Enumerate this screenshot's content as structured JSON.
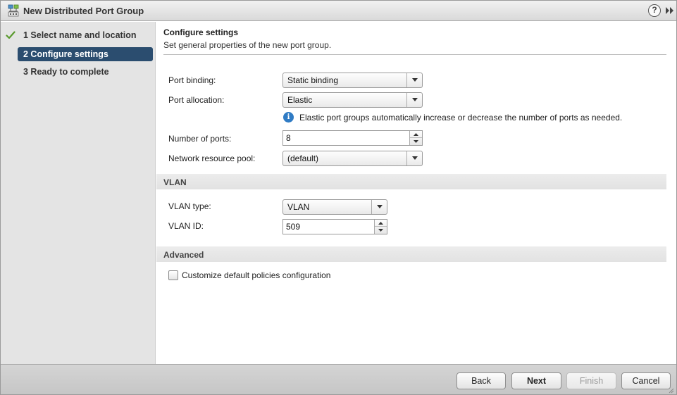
{
  "window": {
    "title": "New Distributed Port Group",
    "help_label": "?",
    "icon": "distributed-port-group-icon"
  },
  "steps": [
    {
      "label": "1  Select name and location",
      "status": "completed"
    },
    {
      "label": "2  Configure settings",
      "status": "active"
    },
    {
      "label": "3  Ready to complete",
      "status": "pending"
    }
  ],
  "main": {
    "title": "Configure settings",
    "subtitle": "Set general properties of the new port group."
  },
  "form": {
    "port_binding": {
      "label": "Port binding:",
      "value": "Static binding"
    },
    "port_allocation": {
      "label": "Port allocation:",
      "value": "Elastic"
    },
    "info": "Elastic port groups automatically increase or decrease the number of ports as needed.",
    "num_ports": {
      "label": "Number of ports:",
      "value": "8"
    },
    "resource_pool": {
      "label": "Network resource pool:",
      "value": "(default)"
    }
  },
  "vlan": {
    "header": "VLAN",
    "type": {
      "label": "VLAN type:",
      "value": "VLAN"
    },
    "id": {
      "label": "VLAN ID:",
      "value": "509"
    }
  },
  "advanced": {
    "header": "Advanced",
    "customize": {
      "label": "Customize default policies configuration",
      "checked": false
    }
  },
  "footer": {
    "back": "Back",
    "next": "Next",
    "finish": "Finish",
    "cancel": "Cancel"
  },
  "colors": {
    "active_step": "#2b4d6f",
    "check": "#5a9a2e",
    "info": "#2f7bc4"
  }
}
